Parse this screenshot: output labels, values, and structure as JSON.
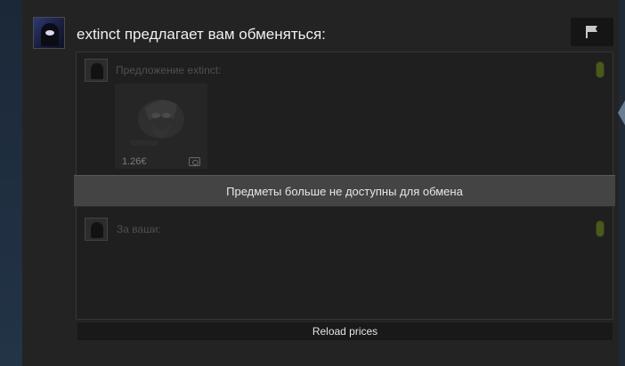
{
  "header": {
    "title": "extinct предлагает вам обменяться:"
  },
  "offer": {
    "their_label": "Предложение extinct:",
    "your_label": "За ваши:",
    "item": {
      "price": "1.26€",
      "icon": "cash-icon"
    },
    "unavailable_message": "Предметы больше не доступны для обмена"
  },
  "actions": {
    "reload_label": "Reload prices"
  },
  "icons": {
    "report": "flag-icon"
  },
  "colors": {
    "background": "#232323",
    "banner": "#444444",
    "ready_indicator": "#4a5a1e"
  }
}
